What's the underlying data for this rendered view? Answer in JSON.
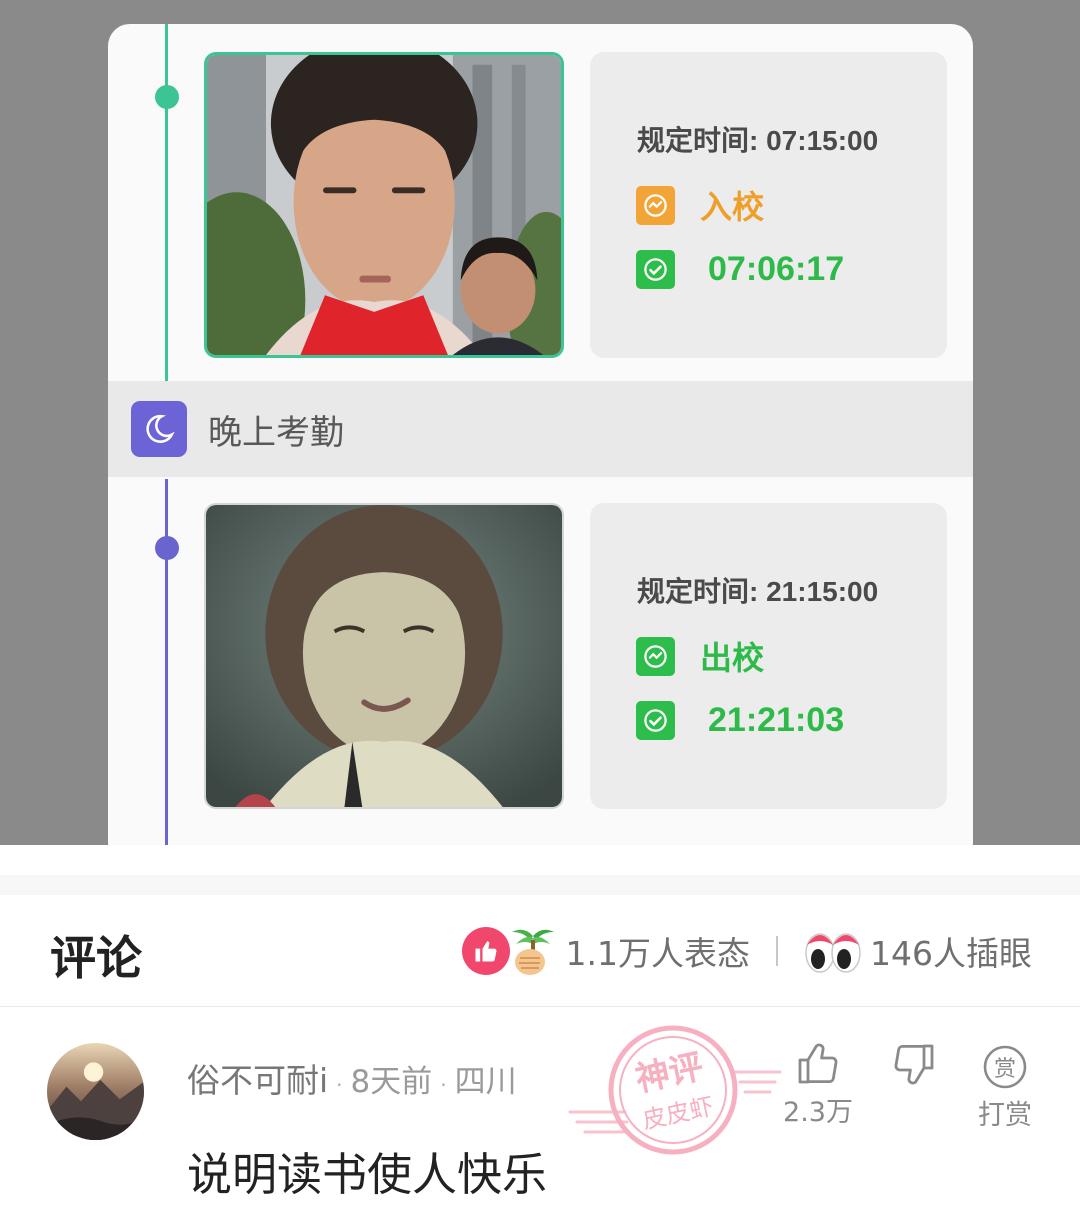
{
  "attendance": {
    "morning": {
      "rule_time": "规定时间: 07:15:00",
      "status": "入校",
      "check_time": "07:06:17"
    },
    "evening_section": {
      "label": "晚上考勤"
    },
    "evening": {
      "rule_time": "规定时间: 21:15:00",
      "status": "出校",
      "check_time": "21:21:03"
    }
  },
  "comments": {
    "title": "评论",
    "reactions_count": "1.1万人表态",
    "viewers_count": "146人插眼",
    "items": [
      {
        "username": "俗不可耐i",
        "time_ago": "8天前",
        "location": "四川",
        "text": "说明读书使人快乐",
        "like_count": "2.3万",
        "tip_label": "打赏",
        "stamp_text": [
          "神评",
          "皮皮虾"
        ]
      }
    ]
  },
  "colors": {
    "accent_green": "#2dba48",
    "accent_orange": "#ee9f2a",
    "evening_purple": "#6c63d6",
    "stamp_pink": "#f5a3b6",
    "reaction_pink": "#f2476d"
  },
  "icons": [
    "moon-icon",
    "clock-icon",
    "check-clock-icon",
    "thumbs-up-icon",
    "thumbs-down-icon",
    "tip-coin-icon",
    "eyes-emoji-icon",
    "palm-emoji-icon"
  ]
}
